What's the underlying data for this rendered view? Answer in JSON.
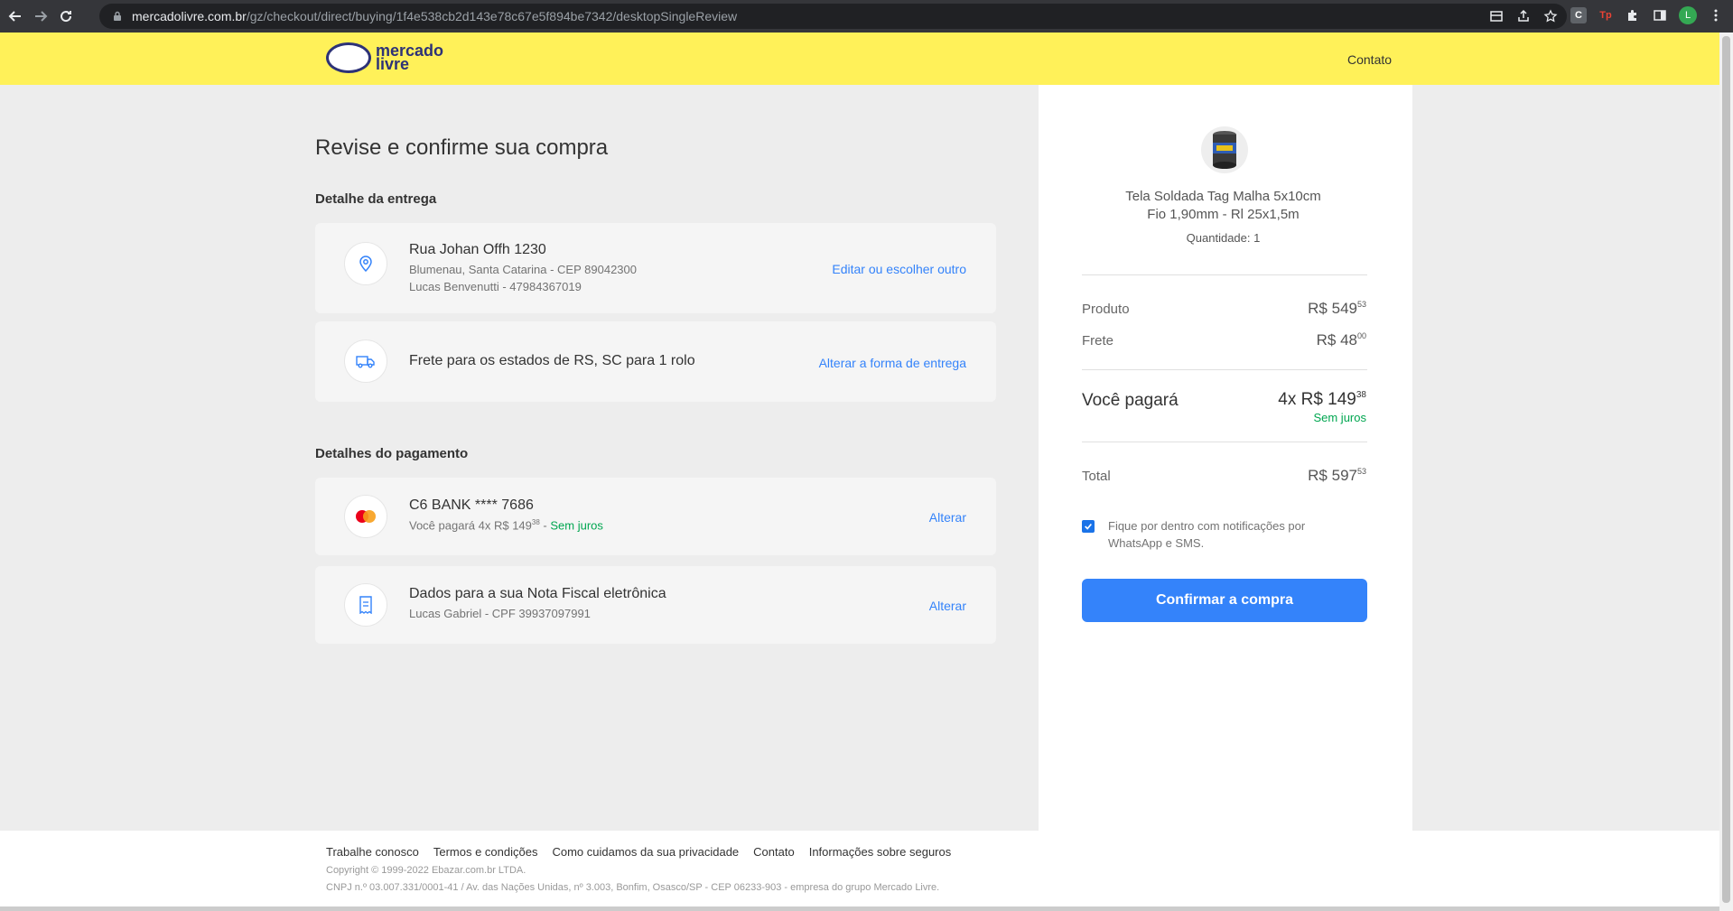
{
  "browser": {
    "url_host": "mercadolivre.com.br",
    "url_path": "/gz/checkout/direct/buying/1f4e538cb2d143e78c67e5f894be7342/desktopSingleReview",
    "profile_initial": "L",
    "ext_c": "C",
    "ext_tp": "Tp"
  },
  "header": {
    "logo_line1": "mercado",
    "logo_line2": "livre",
    "contact": "Contato"
  },
  "page": {
    "title": "Revise e confirme sua compra",
    "delivery_section": "Detalhe da entrega",
    "payment_section": "Detalhes do pagamento"
  },
  "address": {
    "street": "Rua Johan Offh 1230",
    "city": "Blumenau, Santa Catarina - CEP 89042300",
    "contact": "Lucas Benvenutti - 47984367019",
    "action": "Editar ou escolher outro"
  },
  "shipping": {
    "text": "Frete para os estados de RS, SC para 1 rolo",
    "action": "Alterar a forma de entrega"
  },
  "card": {
    "name": "C6 BANK **** 7686",
    "installments_prefix": "Você pagará 4x R$ 149",
    "installments_cents": "38",
    "installments_separator": " - ",
    "interest": "Sem juros",
    "action": "Alterar"
  },
  "invoice": {
    "title": "Dados para a sua Nota Fiscal eletrônica",
    "detail": "Lucas Gabriel - CPF 39937097991",
    "action": "Alterar"
  },
  "summary": {
    "product_line1": "Tela Soldada Tag Malha 5x10cm",
    "product_line2": "Fio 1,90mm - Rl 25x1,5m",
    "quantity": "Quantidade: 1",
    "product_label": "Produto",
    "product_price": "R$ 549",
    "product_cents": "53",
    "shipping_label": "Frete",
    "shipping_price": "R$ 48",
    "shipping_cents": "00",
    "pay_label": "Você pagará",
    "pay_value": "4x R$ 149",
    "pay_cents": "38",
    "pay_note": "Sem juros",
    "total_label": "Total",
    "total_price": "R$ 597",
    "total_cents": "53",
    "notify_text": "Fique por dentro com notificações por WhatsApp e SMS.",
    "confirm": "Confirmar a compra"
  },
  "footer": {
    "links": [
      "Trabalhe conosco",
      "Termos e condições",
      "Como cuidamos da sua privacidade",
      "Contato",
      "Informações sobre seguros"
    ],
    "copyright": "Copyright © 1999-2022 Ebazar.com.br LTDA.",
    "cnpj": "CNPJ n.º 03.007.331/0001-41 / Av. das Nações Unidas, nº 3.003, Bonfim, Osasco/SP - CEP 06233-903 - empresa do grupo Mercado Livre."
  },
  "colors": {
    "brand_yellow": "#fff159",
    "accent_blue": "#3483fa",
    "success_green": "#00a650"
  }
}
